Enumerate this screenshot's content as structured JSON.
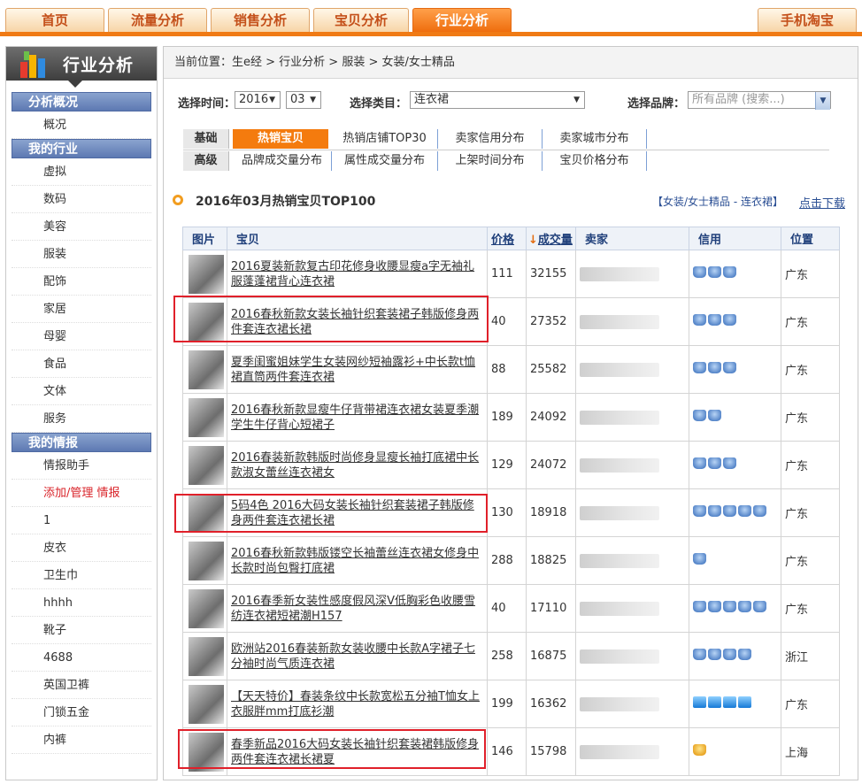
{
  "nav": {
    "tabs": [
      "首页",
      "流量分析",
      "销售分析",
      "宝贝分析",
      "行业分析"
    ],
    "active": 4,
    "right": "手机淘宝"
  },
  "sidebar": {
    "title": "行业分析",
    "sections": [
      {
        "title": "分析概况",
        "items": [
          "概况"
        ]
      },
      {
        "title": "我的行业",
        "items": [
          "虚拟",
          "数码",
          "美容",
          "服装",
          "配饰",
          "家居",
          "母婴",
          "食品",
          "文体",
          "服务"
        ]
      },
      {
        "title": "我的情报",
        "items": [
          "情报助手",
          "添加/管理 情报",
          "1",
          "皮衣",
          "卫生巾",
          "hhhh",
          "靴子",
          "4688",
          "英国卫裤",
          "门锁五金",
          "内裤"
        ]
      }
    ]
  },
  "breadcrumb": "当前位置：生e经 > 行业分析 > 服装 > 女装/女士精品",
  "filters": {
    "time_label": "选择时间：",
    "year": "2016",
    "month": "03",
    "category_label": "选择类目：",
    "category": "连衣裙",
    "brand_label": "选择品牌：",
    "brand_placeholder": "所有品牌 (搜索...)"
  },
  "subtabs": {
    "row1_label": "基础",
    "row1": [
      "热销宝贝TOP100",
      "热销店铺TOP30",
      "卖家信用分布",
      "卖家城市分布"
    ],
    "row2_label": "高级",
    "row2": [
      "品牌成交量分布",
      "属性成交量分布",
      "上架时间分布",
      "宝贝价格分布"
    ]
  },
  "table": {
    "title": "2016年03月热销宝贝TOP100",
    "category_tag": "【女装/女士精品 - 连衣裙】",
    "download": "点击下载",
    "headers": [
      "图片",
      "宝贝",
      "价格",
      "成交量",
      "卖家",
      "信用",
      "位置"
    ],
    "sort_arrow": "↓",
    "rows": [
      {
        "name": "2016夏装新款复古印花修身收腰显瘦a字无袖礼服蓬蓬裙背心连衣裙",
        "price": "111",
        "sales": "32155",
        "credit": "crown",
        "credit_n": 3,
        "loc": "广东"
      },
      {
        "name": "2016春秋新款女装长袖针织套装裙子韩版修身两件套连衣裙长裙",
        "price": "40",
        "sales": "27352",
        "credit": "crown",
        "credit_n": 3,
        "loc": "广东"
      },
      {
        "name": "夏季闺蜜姐妹学生女装网纱短袖露衫+中长款t恤裙直筒两件套连衣裙",
        "price": "88",
        "sales": "25582",
        "credit": "crown",
        "credit_n": 3,
        "loc": "广东"
      },
      {
        "name": "2016春秋新款显瘦牛仔背带裙连衣裙女装夏季潮学生牛仔背心短裙子",
        "price": "189",
        "sales": "24092",
        "credit": "crown",
        "credit_n": 2,
        "loc": "广东"
      },
      {
        "name": "2016春装新款韩版时尚修身显瘦长袖打底裙中长款淑女蕾丝连衣裙女",
        "price": "129",
        "sales": "24072",
        "credit": "crown",
        "credit_n": 3,
        "loc": "广东"
      },
      {
        "name": "5码4色 2016大码女装长袖针织套装裙子韩版修身两件套连衣裙长裙",
        "price": "130",
        "sales": "18918",
        "credit": "crown",
        "credit_n": 5,
        "loc": "广东"
      },
      {
        "name": "2016春秋新款韩版镂空长袖蕾丝连衣裙女修身中长款时尚包臀打底裙",
        "price": "288",
        "sales": "18825",
        "credit": "crown",
        "credit_n": 1,
        "loc": "广东"
      },
      {
        "name": "2016春季新女装性感度假风深V低胸彩色收腰雪纺连衣裙短裙潮H157",
        "price": "40",
        "sales": "17110",
        "credit": "crown",
        "credit_n": 5,
        "loc": "广东"
      },
      {
        "name": "欧洲站2016春装新款女装收腰中长款A字裙子七分袖时尚气质连衣裙",
        "price": "258",
        "sales": "16875",
        "credit": "crown",
        "credit_n": 4,
        "loc": "浙江"
      },
      {
        "name": "【天天特价】春装条纹中长款宽松五分袖T恤女上衣服胖mm打底衫潮",
        "price": "199",
        "sales": "16362",
        "credit": "diamond",
        "credit_n": 4,
        "loc": "广东"
      },
      {
        "name": "春季新品2016大码女装长袖针织套装裙韩版修身两件套连衣裙长裙夏",
        "price": "146",
        "sales": "15798",
        "credit": "gold",
        "credit_n": 1,
        "loc": "上海"
      }
    ]
  },
  "colors": {
    "accent": "#f07a14",
    "nav_blue": "#5d79b2",
    "highlight_red": "#e0202a"
  }
}
